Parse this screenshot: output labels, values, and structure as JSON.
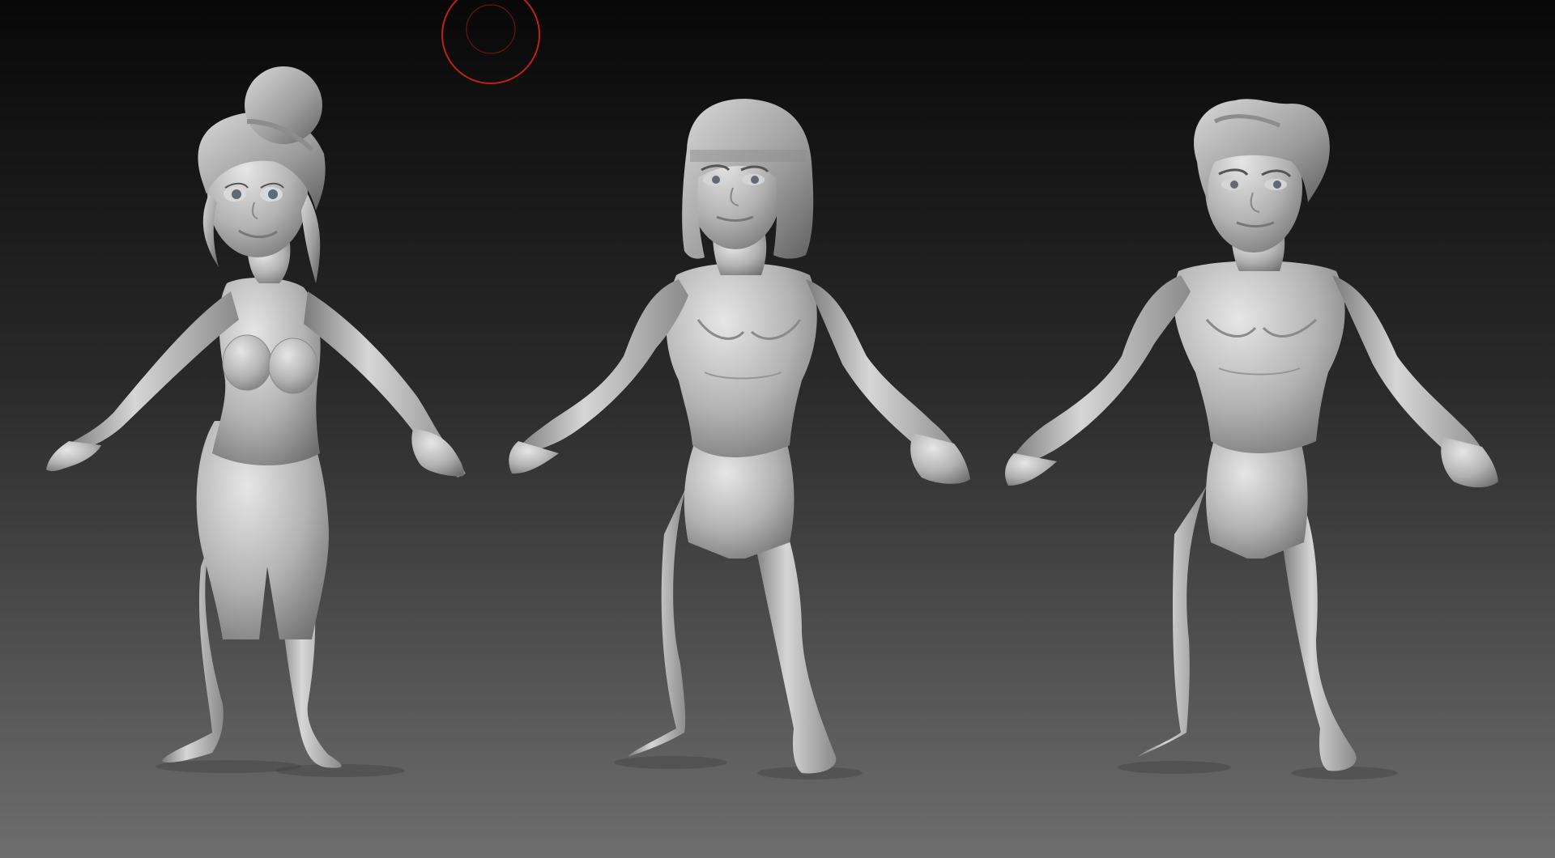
{
  "canvas": {
    "background_top": "#080808",
    "background_mid": "#2a2a2a",
    "background_bottom": "#6e6e6e"
  },
  "sculpt": {
    "material_light": "#e6e6e6",
    "material_mid": "#b2b2b2",
    "material_dark": "#6f6f6f",
    "eye_color": "#5f6a78"
  },
  "draw_cursor": {
    "icon": "brush-draw-size-cursor",
    "color": "#c0201c"
  },
  "figures": [
    {
      "id": "female-cartoon-base-mesh",
      "hair": "updo-bun"
    },
    {
      "id": "male-cartoon-bob-hair",
      "hair": "bob-with-bangs"
    },
    {
      "id": "male-cartoon-swept-hair",
      "hair": "swept-back"
    }
  ]
}
